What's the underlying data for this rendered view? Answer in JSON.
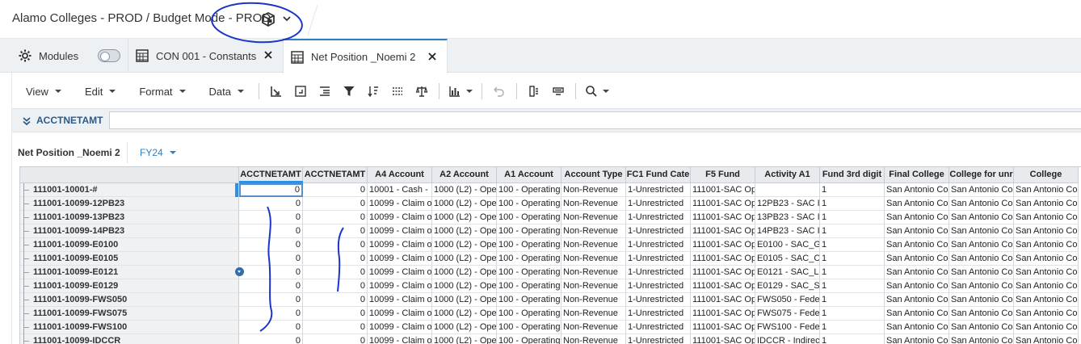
{
  "app": {
    "title": "Alamo Colleges - PROD / Budget Mode - PROD",
    "title_icon": "cube-icon",
    "title_dropdown_icon": "chevron-down-icon"
  },
  "tabs": [
    {
      "label": "Modules",
      "icon": "gear-icon",
      "has_toggle": true,
      "toggle_on": false
    },
    {
      "label": "CON 001 - Constants",
      "icon": "grid-icon",
      "closable": true
    },
    {
      "label": "Net Position _Noemi 2",
      "icon": "grid-icon",
      "closable": true,
      "active": true
    }
  ],
  "toolbar": {
    "menus": [
      "View",
      "Edit",
      "Format",
      "Data"
    ],
    "buttons": [
      "pivot-icon",
      "insert-icon",
      "indent-icon",
      "filter-icon",
      "sort-icon",
      "columns-icon",
      "balance-icon",
      "chart-icon",
      "undo-icon",
      "export-column-icon",
      "view-icon",
      "search-icon"
    ]
  },
  "pov": {
    "label": "ACCTNETAMT",
    "value": ""
  },
  "sheet": {
    "name": "Net Position _Noemi 2",
    "filter": "FY24"
  },
  "grid": {
    "columns": [
      "ACCTNETAMT",
      "ACCTNETAMT",
      "A4 Account",
      "A2 Account",
      "A1 Account",
      "Account Type",
      "FC1 Fund Cate",
      "F5 Fund",
      "Activity A1",
      "Fund 3rd digit",
      "Final College",
      "College for unr",
      "College"
    ],
    "rows": [
      {
        "label": "111001-10001-#",
        "cells": [
          "0",
          "0",
          "10001 - Cash -",
          "1000 (L2) - Ope",
          "100 - Operating",
          "Non-Revenue",
          "1-Unrestricted",
          "111001-SAC Op",
          "",
          "1",
          "San Antonio Co",
          "San Antonio Co",
          "San Antonio Co"
        ]
      },
      {
        "label": "111001-10099-12PB23",
        "cells": [
          "0",
          "0",
          "10099 - Claim o",
          "1000 (L2) - Ope",
          "100 - Operating",
          "Non-Revenue",
          "1-Unrestricted",
          "111001-SAC Op",
          "12PB23 - SAC I",
          "1",
          "San Antonio Co",
          "San Antonio Co",
          "San Antonio Co"
        ]
      },
      {
        "label": "111001-10099-13PB23",
        "cells": [
          "0",
          "0",
          "10099 - Claim o",
          "1000 (L2) - Ope",
          "100 - Operating",
          "Non-Revenue",
          "1-Unrestricted",
          "111001-SAC Op",
          "13PB23 - SAC I",
          "1",
          "San Antonio Co",
          "San Antonio Co",
          "San Antonio Co"
        ]
      },
      {
        "label": "111001-10099-14PB23",
        "cells": [
          "0",
          "0",
          "10099 - Claim o",
          "1000 (L2) - Ope",
          "100 - Operating",
          "Non-Revenue",
          "1-Unrestricted",
          "111001-SAC Op",
          "14PB23 - SAC I",
          "1",
          "San Antonio Co",
          "San Antonio Co",
          "San Antonio Co"
        ]
      },
      {
        "label": "111001-10099-E0100",
        "cells": [
          "0",
          "0",
          "10099 - Claim o",
          "1000 (L2) - Ope",
          "100 - Operating",
          "Non-Revenue",
          "1-Unrestricted",
          "111001-SAC Op",
          "E0100 - SAC_G",
          "1",
          "San Antonio Co",
          "San Antonio Co",
          "San Antonio Co"
        ]
      },
      {
        "label": "111001-10099-E0105",
        "cells": [
          "0",
          "0",
          "10099 - Claim o",
          "1000 (L2) - Ope",
          "100 - Operating",
          "Non-Revenue",
          "1-Unrestricted",
          "111001-SAC Op",
          "E0105 - SAC_C",
          "1",
          "San Antonio Co",
          "San Antonio Co",
          "San Antonio Co"
        ]
      },
      {
        "label": "111001-10099-E0121",
        "cells": [
          "0",
          "0",
          "10099 - Claim o",
          "1000 (L2) - Ope",
          "100 - Operating",
          "Non-Revenue",
          "1-Unrestricted",
          "111001-SAC Op",
          "E0121 - SAC_L",
          "1",
          "San Antonio Co",
          "San Antonio Co",
          "San Antonio Co"
        ]
      },
      {
        "label": "111001-10099-E0129",
        "cells": [
          "0",
          "0",
          "10099 - Claim o",
          "1000 (L2) - Ope",
          "100 - Operating",
          "Non-Revenue",
          "1-Unrestricted",
          "111001-SAC Op",
          "E0129 - SAC_S",
          "1",
          "San Antonio Co",
          "San Antonio Co",
          "San Antonio Co"
        ]
      },
      {
        "label": "111001-10099-FWS050",
        "cells": [
          "0",
          "0",
          "10099 - Claim o",
          "1000 (L2) - Ope",
          "100 - Operating",
          "Non-Revenue",
          "1-Unrestricted",
          "111001-SAC Op",
          "FWS050 - Fede",
          "1",
          "San Antonio Co",
          "San Antonio Co",
          "San Antonio Co"
        ]
      },
      {
        "label": "111001-10099-FWS075",
        "cells": [
          "0",
          "0",
          "10099 - Claim o",
          "1000 (L2) - Ope",
          "100 - Operating",
          "Non-Revenue",
          "1-Unrestricted",
          "111001-SAC Op",
          "FWS075 - Fede",
          "1",
          "San Antonio Co",
          "San Antonio Co",
          "San Antonio Co"
        ]
      },
      {
        "label": "111001-10099-FWS100",
        "cells": [
          "0",
          "0",
          "10099 - Claim o",
          "1000 (L2) - Ope",
          "100 - Operating",
          "Non-Revenue",
          "1-Unrestricted",
          "111001-SAC Op",
          "FWS100 - Fede",
          "1",
          "San Antonio Co",
          "San Antonio Co",
          "San Antonio Co"
        ]
      },
      {
        "label": "111001-10099-IDCCR",
        "cells": [
          "0",
          "0",
          "10099 - Claim o",
          "1000 (L2) - Ope",
          "100 - Operating",
          "Non-Revenue",
          "1-Unrestricted",
          "111001-SAC Op",
          "IDCCR - Indirec",
          "1",
          "San Antonio Co",
          "San Antonio Co",
          "San Antonio Co"
        ]
      }
    ]
  },
  "colors": {
    "accent": "#2f7fc1",
    "annotation_ink": "#1a35c8",
    "header_bg": "#e8eaed",
    "pov_label": "#2c5b8a"
  }
}
